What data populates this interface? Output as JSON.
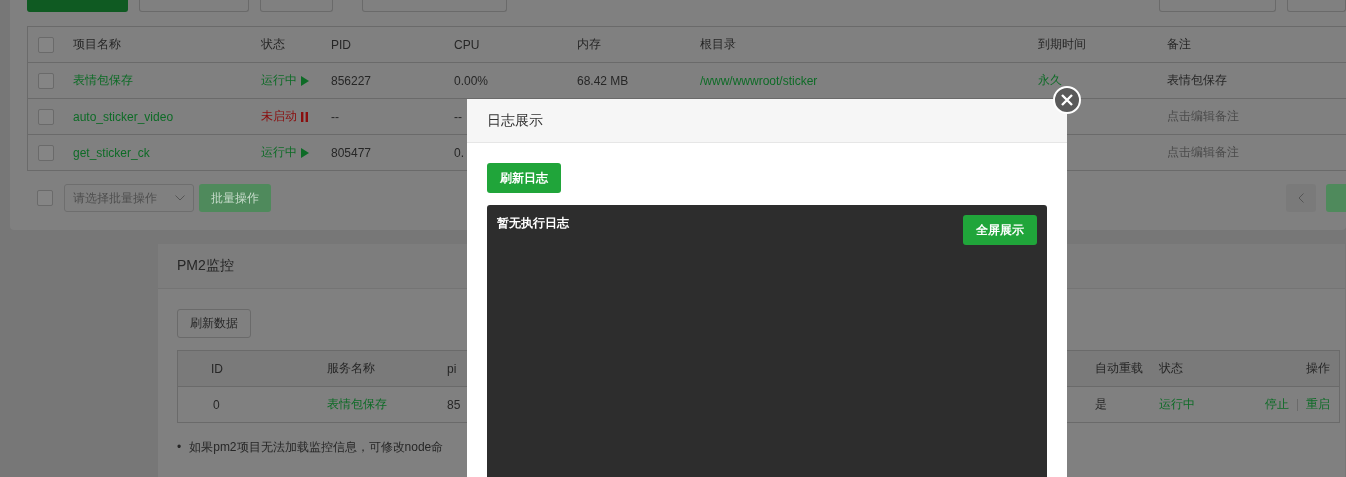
{
  "project_table": {
    "select_all_checked": false,
    "columns": [
      "项目名称",
      "状态",
      "PID",
      "CPU",
      "内存",
      "根目录",
      "到期时间",
      "备注"
    ],
    "rows": [
      {
        "checked": false,
        "name": "表情包保存",
        "status": "运行中",
        "running": true,
        "pid": "856227",
        "cpu": "0.00%",
        "memory": "68.42 MB",
        "root": "/www/wwwroot/sticker",
        "expiry": "永久",
        "remark": "表情包保存",
        "remark_is_hint": false
      },
      {
        "checked": false,
        "name": "auto_sticker_video",
        "status": "未启动",
        "running": false,
        "pid": "--",
        "cpu": "--",
        "remark": "点击编辑备注",
        "remark_is_hint": true
      },
      {
        "checked": false,
        "name": "get_sticker_ck",
        "status": "运行中",
        "running": true,
        "pid": "805477",
        "cpu": "0.",
        "remark": "点击编辑备注",
        "remark_is_hint": true
      }
    ]
  },
  "batch": {
    "checked": false,
    "placeholder": "请选择批量操作",
    "button": "批量操作"
  },
  "pm2_panel": {
    "title": "PM2监控",
    "refresh_button": "刷新数据",
    "columns": [
      "ID",
      "服务名称",
      "pi",
      "自动重载",
      "状态",
      "操作"
    ],
    "rows": [
      {
        "id": "0",
        "name": "表情包保存",
        "pid": "85",
        "auto_reload": "是",
        "status": "运行中",
        "actions": [
          "停止",
          "重启"
        ]
      }
    ],
    "notes": [
      {
        "bullet": "•",
        "text": "如果pm2项目无法加载监控信息，可修改node命"
      }
    ]
  },
  "log_dialog": {
    "title": "日志展示",
    "refresh_button": "刷新日志",
    "log_text": "暂无执行日志",
    "fullscreen_button": "全屏展示"
  }
}
